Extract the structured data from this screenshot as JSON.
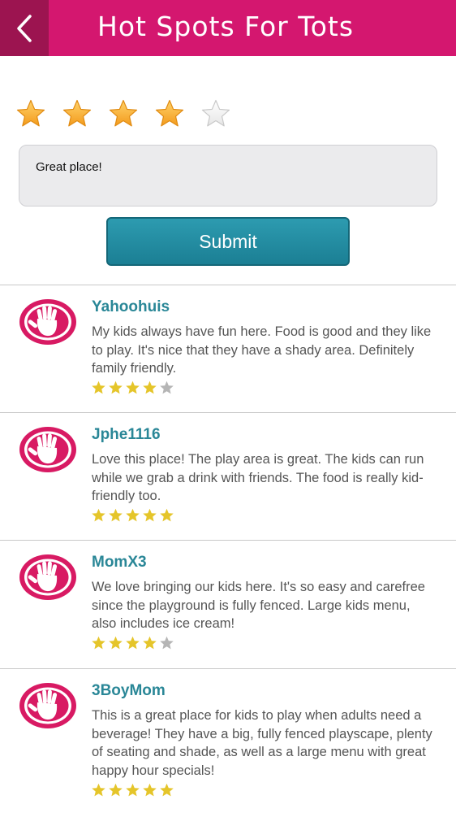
{
  "header": {
    "title": "Hot Spots For Tots",
    "back_icon": "chevron-left-icon"
  },
  "rating_input": {
    "value": 4,
    "max": 5
  },
  "comment": {
    "value": "Great place!"
  },
  "submit": {
    "label": "Submit"
  },
  "colors": {
    "brand_pink": "#d4176f",
    "back_button": "#9c1450",
    "accent_teal": "#1f8a9c",
    "star_gold": "#e5c52a",
    "star_gray": "#b5b5b5"
  },
  "reviews": [
    {
      "name": "Yahoohuis",
      "text": "My kids always have fun here. Food is good and they like to play. It's nice that they have a shady area. Definitely family friendly.",
      "rating": 4
    },
    {
      "name": "Jphe1116",
      "text": "Love this place! The play area is great. The kids can run while we grab a drink with friends. The food is really kid-friendly too.",
      "rating": 5
    },
    {
      "name": "MomX3",
      "text": "We love bringing our kids here. It's so easy and carefree since the playground is fully fenced. Large kids menu, also includes ice cream!",
      "rating": 4
    },
    {
      "name": "3BoyMom",
      "text": "This is a great place for kids to play when adults need a beverage! They have a big, fully fenced playscape, plenty of seating and shade, as well as a large menu with great happy hour specials!",
      "rating": 5
    }
  ]
}
